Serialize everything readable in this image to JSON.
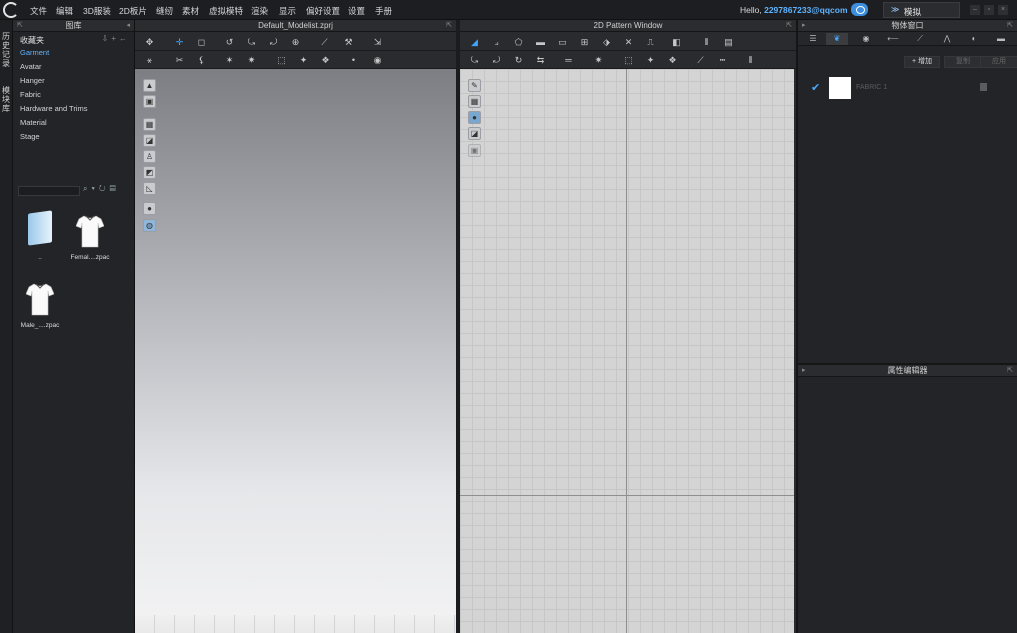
{
  "menubar": {
    "items": [
      "文件",
      "编辑",
      "3D服装",
      "2D板片",
      "缝纫",
      "素材",
      "虚拟模特",
      "渲染",
      "显示",
      "偏好设置",
      "设置",
      "手册"
    ],
    "hello_prefix": "Hello, ",
    "user": "2297867233@qqcom",
    "mode": "模拟",
    "chevron": "chevron-double-down-icon"
  },
  "left_tabs": [
    "历史记录",
    "模块库"
  ],
  "library": {
    "title": "图库",
    "favorites": "收藏夹",
    "categories": [
      "Garment",
      "Avatar",
      "Hanger",
      "Fabric",
      "Hardware and Trims",
      "Material",
      "Stage"
    ],
    "selected_category": "Garment",
    "thumbnails": [
      {
        "label": "..",
        "icon": "folder-icon"
      },
      {
        "label": "Femal....zpac",
        "icon": "tshirt-icon"
      },
      {
        "label": "Male_....zpac",
        "icon": "tshirt-icon"
      }
    ]
  },
  "viewport3d": {
    "title": "Default_Modelist.zprj"
  },
  "pattern2d": {
    "title": "2D Pattern Window"
  },
  "object_window": {
    "title": "物体窗口",
    "add_label": "增加",
    "copy_label": "复制",
    "apply_label": "应用",
    "fabric_name": "FABRIC 1",
    "fabric_color": "#ffffff"
  },
  "property_editor": {
    "title": "属性编辑器"
  },
  "colors": {
    "accent": "#49a8ff",
    "bg": "#232427"
  }
}
